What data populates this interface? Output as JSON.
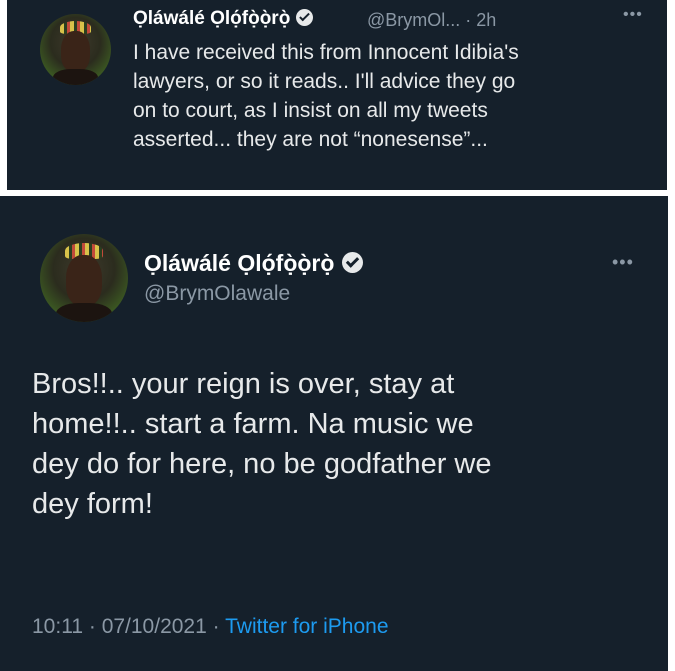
{
  "top_tweet": {
    "author_name": "Ọláwálé Ọlọ́fọ̀ọ̀rọ̀",
    "handle": "@BrymOl...",
    "time": "· 2h",
    "more_icon": "more-dots-icon",
    "text": "I have received this from Innocent Idibia's\nlawyers, or so it reads.. I'll advice they go\non to court, as I insist on all my tweets\nasserted... they are not “nonesense”..."
  },
  "bottom_tweet": {
    "author_name": "Ọláwálé Ọlọ́fọ̀ọ̀rọ̀",
    "handle": "@BrymOlawale",
    "more_icon": "more-dots-icon",
    "text": "Bros!!.. your reign is over, stay at\nhome!!.. start a farm. Na music we\ndey do for here, no be godfather we\ndey form!",
    "time": "10:11",
    "date": "07/10/2021",
    "separator": "·",
    "source": "Twitter for iPhone"
  },
  "colors": {
    "background": "#15202b",
    "text": "#e7e9ea",
    "muted": "#8b98a5",
    "link": "#1d9bf0"
  },
  "icons": {
    "verified": "verified-badge-icon",
    "more": "more-dots-icon"
  }
}
